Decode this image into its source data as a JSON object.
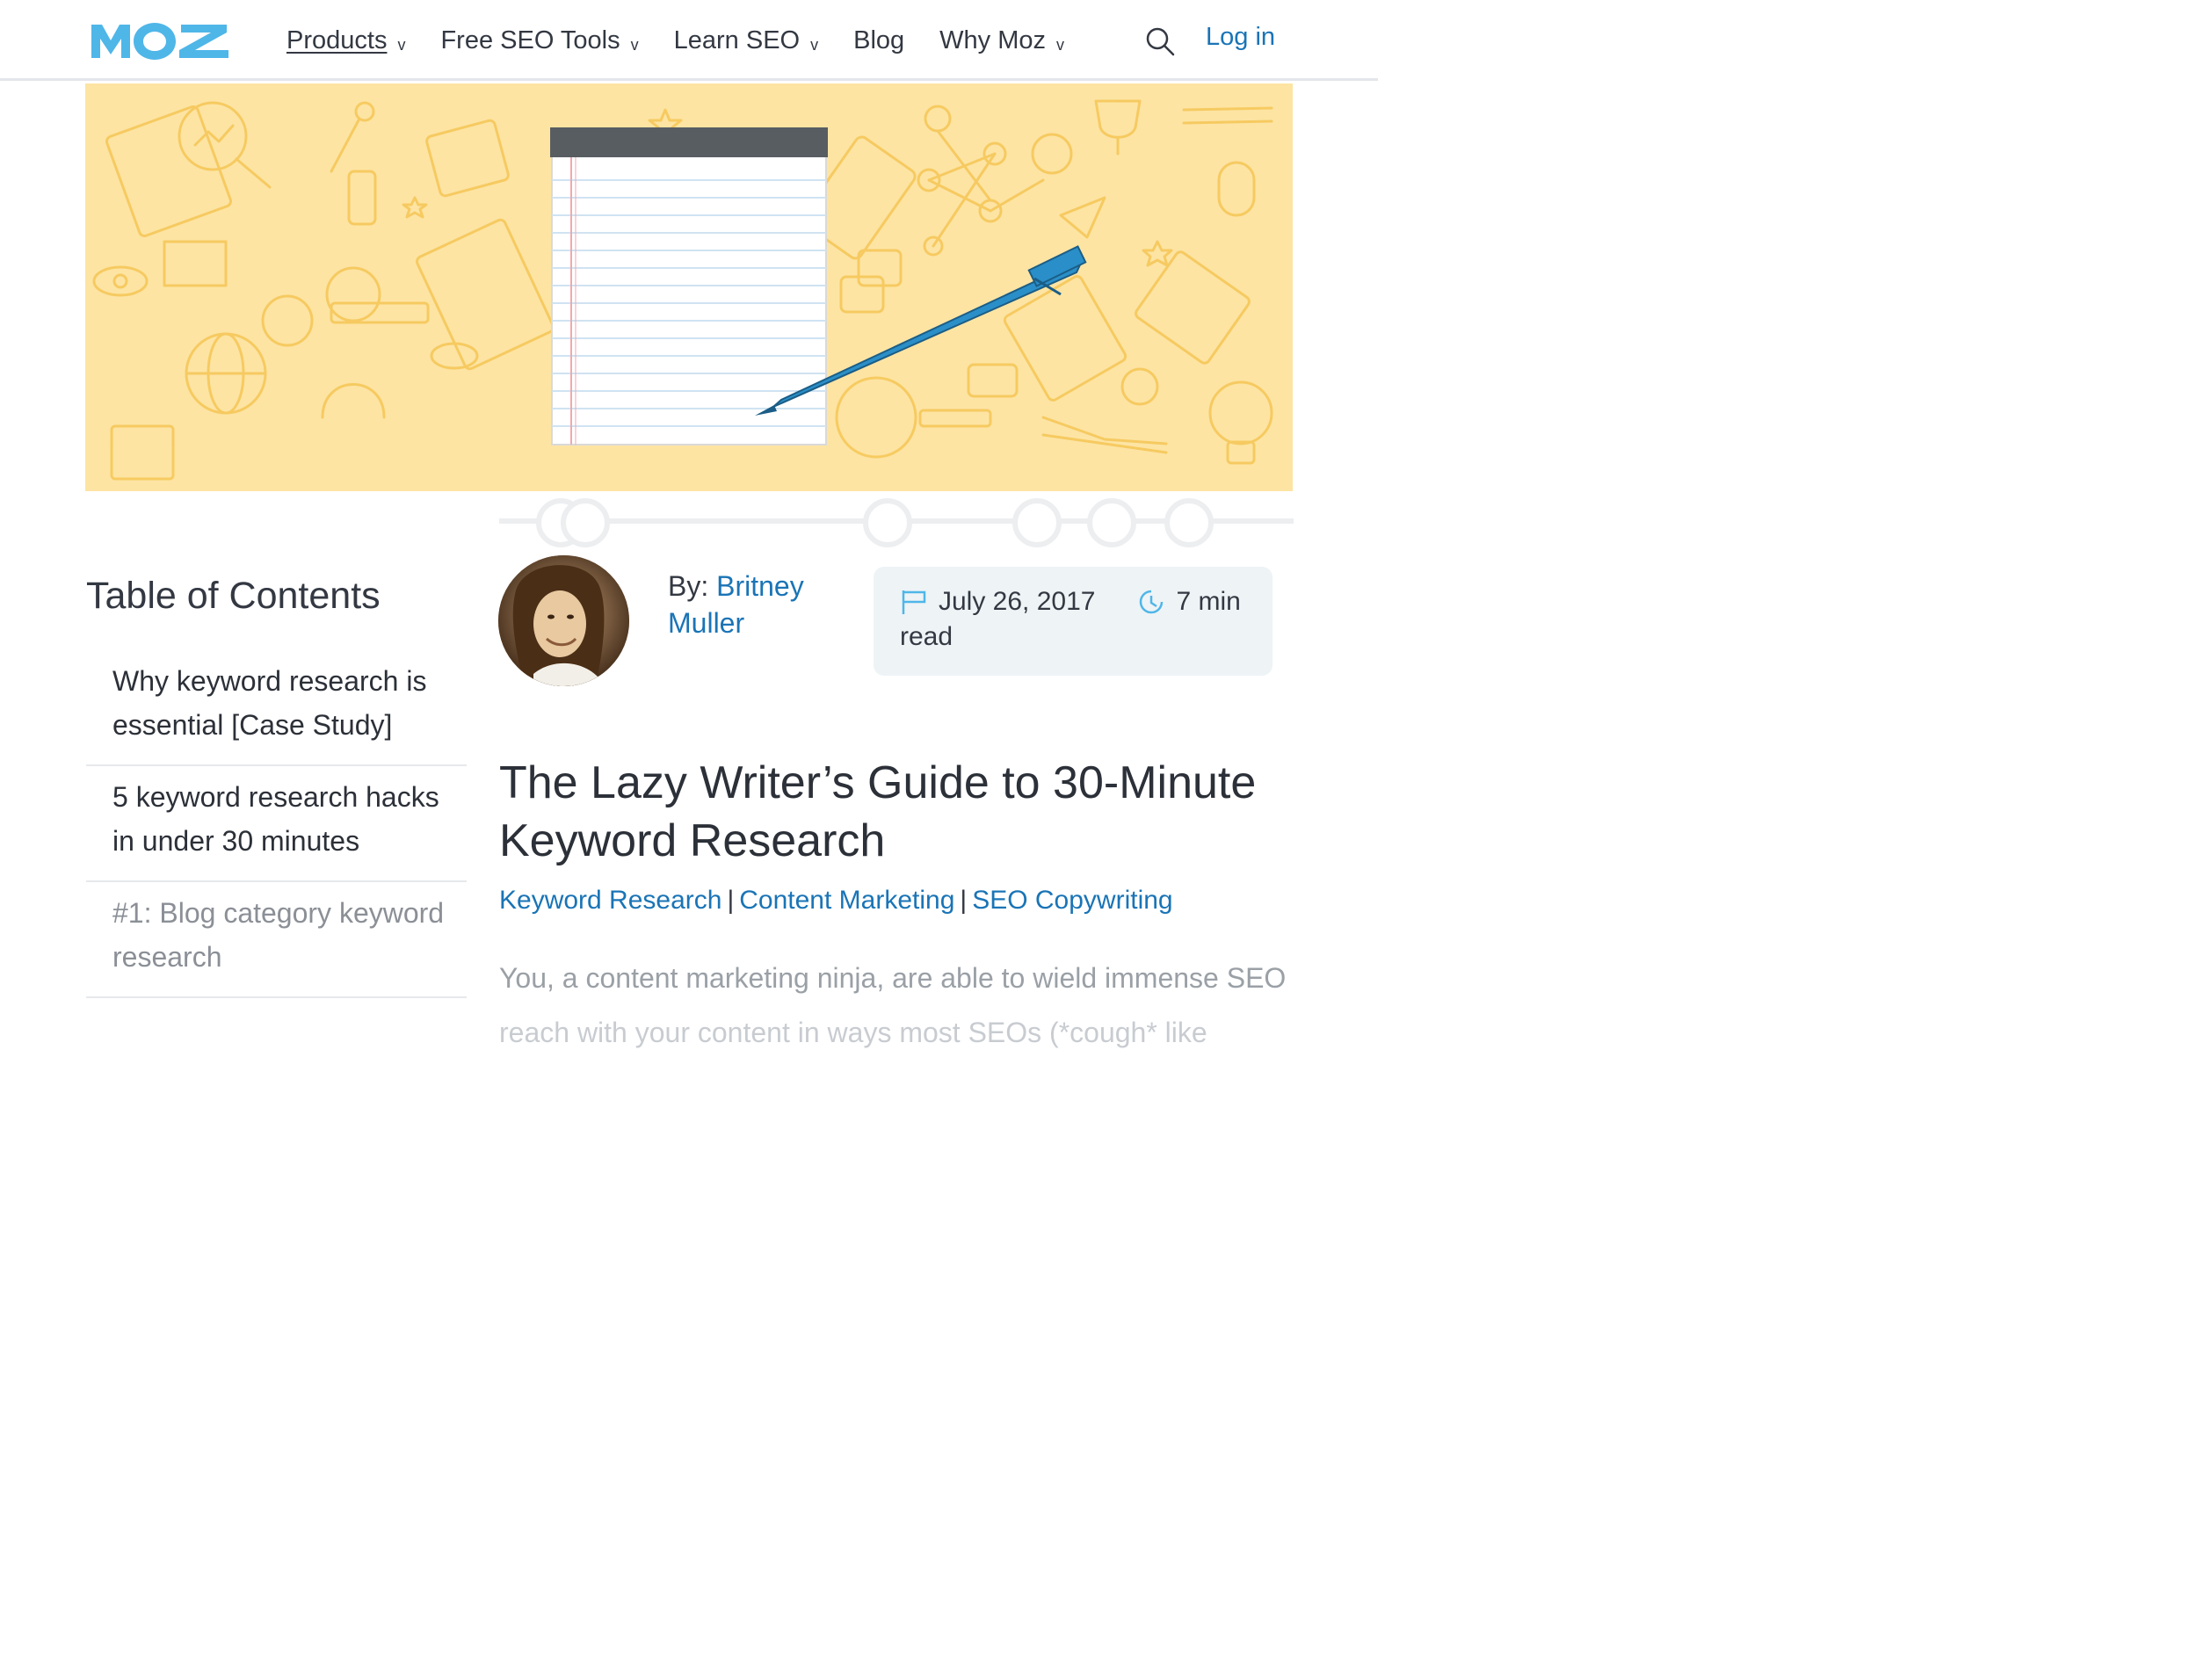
{
  "header": {
    "logo_text": "MOZ",
    "nav": [
      {
        "label": "Products",
        "has_dropdown": true,
        "active": true
      },
      {
        "label": "Free SEO Tools",
        "has_dropdown": true
      },
      {
        "label": "Learn SEO",
        "has_dropdown": true
      },
      {
        "label": "Blog",
        "has_dropdown": false
      },
      {
        "label": "Why Moz",
        "has_dropdown": true
      }
    ],
    "chevron": "v",
    "search_icon": "search-icon",
    "login_label": "Log in"
  },
  "hero": {
    "illustration": "yellow-line-art-pattern with notepad and blue pen"
  },
  "toc": {
    "title": "Table of Contents",
    "items": [
      {
        "label": "Why keyword research is essential [Case Study]"
      },
      {
        "label": "5 keyword research hacks in under 30 minutes"
      },
      {
        "label": "#1: Blog category keyword research"
      }
    ]
  },
  "author": {
    "by_prefix": "By:",
    "name_first": "Britney",
    "name_last": "Muller"
  },
  "meta": {
    "date": "July 26, 2017",
    "read_time_a": "7 min",
    "read_time_b": "read"
  },
  "article": {
    "title": "The Lazy Writer’s Guide to 30-Minute Keyword Research",
    "tags": [
      "Keyword Research",
      "Content Marketing",
      "SEO Copywriting"
    ],
    "tag_separator": "|",
    "intro_line1": "You, a content marketing ninja, are able to wield immense SEO",
    "intro_line2": "reach with your content in ways most SEOs (*cough* like"
  },
  "colors": {
    "brand_blue": "#4fb6e8",
    "link_blue": "#1a74b6",
    "hero_bg": "#fde4a3",
    "hero_lines": "#f6c85a",
    "meta_bg": "#eef3f6"
  }
}
